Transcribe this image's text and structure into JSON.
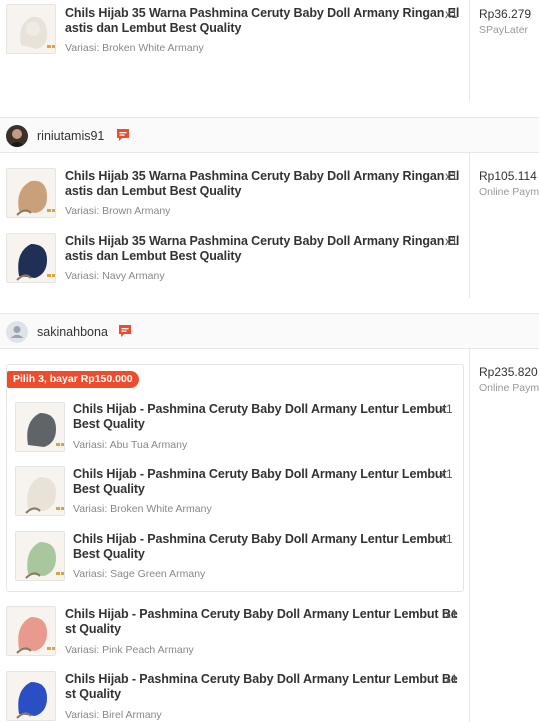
{
  "groups": [
    {
      "items": [
        {
          "title_l1": "Chils Hijab 35 Warna Pashmina Ceruty Baby Doll Armany Ringan El",
          "title_l2": "astis dan Lembut Best Quality",
          "qty": "x1",
          "variant": "Variasi: Broken White Armany",
          "color": "#e8e2d8"
        }
      ],
      "price": "Rp36.279",
      "payment": "SPayLater"
    },
    {
      "shop": "riniutamis91",
      "items": [
        {
          "title_l1": "Chils Hijab 35 Warna Pashmina Ceruty Baby Doll Armany Ringan El",
          "title_l2": "astis dan Lembut Best Quality",
          "qty": "x1",
          "variant": "Variasi: Brown Armany",
          "color": "#c9a07a"
        },
        {
          "title_l1": "Chils Hijab 35 Warna Pashmina Ceruty Baby Doll Armany Ringan El",
          "title_l2": "astis dan Lembut Best Quality",
          "qty": "x1",
          "variant": "Variasi: Navy Armany",
          "color": "#1f2f55"
        }
      ],
      "price": "Rp105.114",
      "payment": "Online Paym"
    },
    {
      "shop": "sakinahbona",
      "promo": "Pilih 3, bayar Rp150.000",
      "bundle_items": [
        {
          "title_l1": "Chils Hijab - Pashmina Ceruty Baby Doll Armany Lentur Lembut",
          "title_l2": "Best Quality",
          "qty": "x1",
          "variant": "Variasi: Abu Tua Armany",
          "color": "#5e6468"
        },
        {
          "title_l1": "Chils Hijab - Pashmina Ceruty Baby Doll Armany Lentur Lembut",
          "title_l2": "Best Quality",
          "qty": "x1",
          "variant": "Variasi: Broken White Armany",
          "color": "#e8e2d8"
        },
        {
          "title_l1": "Chils Hijab - Pashmina Ceruty Baby Doll Armany Lentur Lembut",
          "title_l2": "Best Quality",
          "qty": "x1",
          "variant": "Variasi: Sage Green Armany",
          "color": "#a8c79f"
        }
      ],
      "items": [
        {
          "title_l1": "Chils Hijab - Pashmina Ceruty Baby Doll Armany Lentur Lembut Be",
          "title_l2": "st Quality",
          "qty": "x1",
          "variant": "Variasi: Pink Peach Armany",
          "color": "#e99a8e"
        },
        {
          "title_l1": "Chils Hijab - Pashmina Ceruty Baby Doll Armany Lentur Lembut Be",
          "title_l2": "st Quality",
          "qty": "x1",
          "variant": "Variasi: Birel Armany",
          "color": "#2a4fc4"
        }
      ],
      "price": "Rp235.820",
      "payment": "Online Paym"
    }
  ],
  "colors": {
    "accent": "#ee4d2d"
  }
}
